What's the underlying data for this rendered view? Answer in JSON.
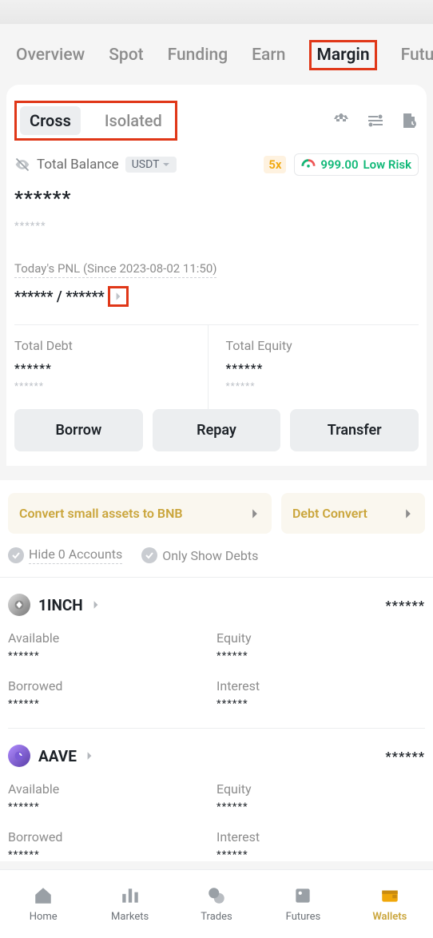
{
  "top_tabs": {
    "items": [
      "Overview",
      "Spot",
      "Funding",
      "Earn",
      "Margin",
      "Futu"
    ],
    "active": "Margin"
  },
  "sub_tabs": {
    "items": [
      "Cross",
      "Isolated"
    ],
    "active": "Cross"
  },
  "balance": {
    "label": "Total Balance",
    "ccy": "USDT",
    "leverage": "5x",
    "risk_value": "999.00",
    "risk_label": "Low Risk",
    "masked_main": "******",
    "masked_sub": "******"
  },
  "pnl": {
    "label": "Today's PNL (Since 2023-08-02 11:50)",
    "value": "****** / ******"
  },
  "debt": {
    "label": "Total Debt",
    "v1": "******",
    "v2": "******"
  },
  "equity": {
    "label": "Total Equity",
    "v1": "******",
    "v2": "******"
  },
  "actions": {
    "borrow": "Borrow",
    "repay": "Repay",
    "transfer": "Transfer"
  },
  "convert": {
    "bnb": "Convert small assets to BNB",
    "debt": "Debt Convert"
  },
  "filters": {
    "hide": "Hide 0 Accounts",
    "debts": "Only Show Debts"
  },
  "asset_fields": {
    "available": "Available",
    "equity": "Equity",
    "borrowed": "Borrowed",
    "interest": "Interest"
  },
  "assets": [
    {
      "symbol": "1INCH",
      "amount": "******",
      "available": "******",
      "equity": "******",
      "borrowed": "******",
      "interest": "******"
    },
    {
      "symbol": "AAVE",
      "amount": "******",
      "available": "******",
      "equity": "******",
      "borrowed": "******",
      "interest": "******"
    }
  ],
  "nav": {
    "items": [
      "Home",
      "Markets",
      "Trades",
      "Futures",
      "Wallets"
    ],
    "active": "Wallets"
  }
}
